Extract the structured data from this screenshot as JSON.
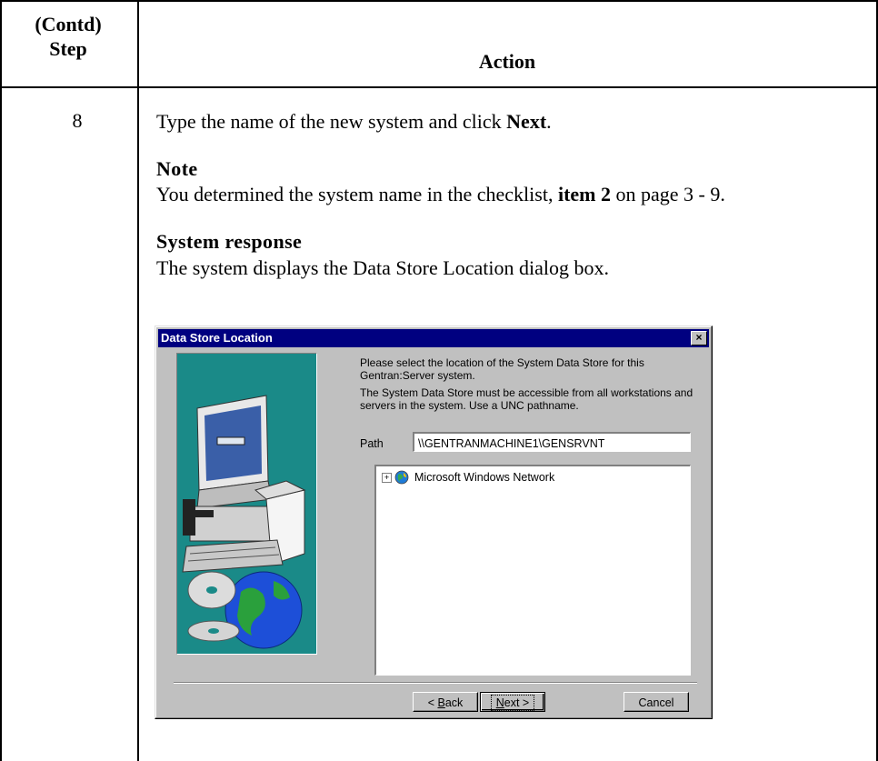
{
  "header": {
    "step_col_line1": "(Contd)",
    "step_col_line2": "Step",
    "action_col": "Action"
  },
  "row": {
    "step": "8",
    "instruction_pre": "Type the name of the new system and click ",
    "instruction_bold": "Next",
    "instruction_post": ".",
    "note_heading": "Note",
    "note_pre": "You determined the system name in the checklist, ",
    "note_bold": "item 2",
    "note_post": " on page 3 - 9.",
    "response_heading": "System response",
    "response_text": "The system displays the Data Store Location dialog box."
  },
  "dialog": {
    "title": "Data Store Location",
    "close_glyph": "×",
    "text1": "Please select the location of the System Data Store for this Gentran:Server system.",
    "text2": "The System Data Store must be accessible from all workstations and servers in the system. Use a UNC pathname.",
    "path_label": "Path",
    "path_value": "\\\\GENTRANMACHINE1\\GENSRVNT",
    "tree_expand_glyph": "+",
    "tree_item": "Microsoft Windows Network",
    "tree_icon": "globe-network-icon",
    "illustration_icon": "computer-cd-globe-illustration",
    "buttons": {
      "back_underlined": "B",
      "back_rest": "ack",
      "back_prefix": "< ",
      "next_underlined": "N",
      "next_rest": "ext >",
      "cancel": "Cancel"
    }
  },
  "colors": {
    "titlebar": "#000080",
    "dialog_face": "#c0c0c0",
    "illustration_bg": "#1a8a88"
  }
}
